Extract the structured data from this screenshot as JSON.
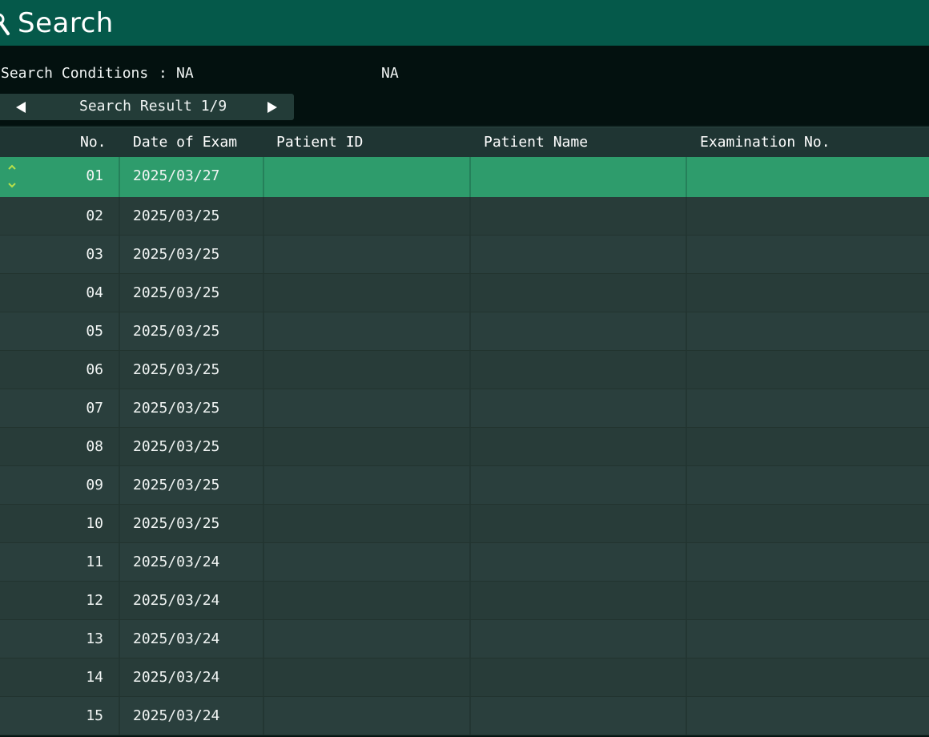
{
  "header": {
    "title": "Search",
    "icon": "search-icon"
  },
  "conditions": {
    "label": "Search Conditions",
    "separator": ":",
    "value1": "NA",
    "value2": "NA"
  },
  "pager": {
    "label": "Search Result 1/9",
    "prev_icon": "triangle-left-icon",
    "next_icon": "triangle-right-icon"
  },
  "table": {
    "columns": {
      "no": "No.",
      "date": "Date of Exam",
      "patient_id": "Patient ID",
      "patient_name": "Patient Name",
      "exam_no": "Examination No."
    },
    "rows": [
      {
        "no": "01",
        "date": "2025/03/27",
        "patient_id": "",
        "patient_name": "",
        "exam_no": ""
      },
      {
        "no": "02",
        "date": "2025/03/25",
        "patient_id": "",
        "patient_name": "",
        "exam_no": ""
      },
      {
        "no": "03",
        "date": "2025/03/25",
        "patient_id": "",
        "patient_name": "",
        "exam_no": ""
      },
      {
        "no": "04",
        "date": "2025/03/25",
        "patient_id": "",
        "patient_name": "",
        "exam_no": ""
      },
      {
        "no": "05",
        "date": "2025/03/25",
        "patient_id": "",
        "patient_name": "",
        "exam_no": ""
      },
      {
        "no": "06",
        "date": "2025/03/25",
        "patient_id": "",
        "patient_name": "",
        "exam_no": ""
      },
      {
        "no": "07",
        "date": "2025/03/25",
        "patient_id": "",
        "patient_name": "",
        "exam_no": ""
      },
      {
        "no": "08",
        "date": "2025/03/25",
        "patient_id": "",
        "patient_name": "",
        "exam_no": ""
      },
      {
        "no": "09",
        "date": "2025/03/25",
        "patient_id": "",
        "patient_name": "",
        "exam_no": ""
      },
      {
        "no": "10",
        "date": "2025/03/25",
        "patient_id": "",
        "patient_name": "",
        "exam_no": ""
      },
      {
        "no": "11",
        "date": "2025/03/24",
        "patient_id": "",
        "patient_name": "",
        "exam_no": ""
      },
      {
        "no": "12",
        "date": "2025/03/24",
        "patient_id": "",
        "patient_name": "",
        "exam_no": ""
      },
      {
        "no": "13",
        "date": "2025/03/24",
        "patient_id": "",
        "patient_name": "",
        "exam_no": ""
      },
      {
        "no": "14",
        "date": "2025/03/24",
        "patient_id": "",
        "patient_name": "",
        "exam_no": ""
      },
      {
        "no": "15",
        "date": "2025/03/24",
        "patient_id": "",
        "patient_name": "",
        "exam_no": ""
      }
    ],
    "selected_row": 0
  },
  "colors": {
    "title_bar": "#05594a",
    "selected_row": "#2e9c6c",
    "row": "#2a3f3d",
    "sort_arrow": "#b8e04a"
  }
}
